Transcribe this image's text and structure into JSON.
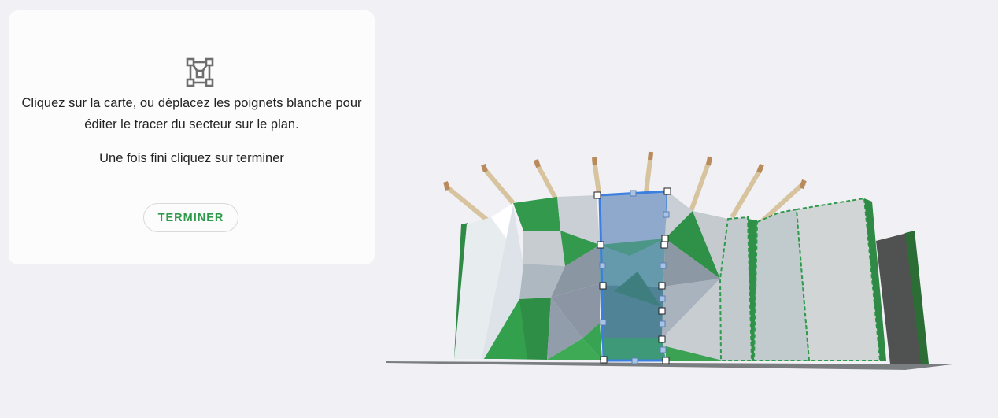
{
  "panel": {
    "icon": "vector-polygon-icon",
    "instruction_line1": "Cliquez sur la carte, ou déplacez les poignets blanche pour",
    "instruction_line2": "éditer le tracer du secteur sur le plan.",
    "instruction_secondary": "Une fois fini cliquez sur terminer",
    "done_button": "TERMINER"
  },
  "colors": {
    "background": "#f0f0f5",
    "accent_green": "#2e9a4b",
    "selection_blue": "#3b7fe0",
    "sector_dashed_green": "#2e9a4b"
  }
}
